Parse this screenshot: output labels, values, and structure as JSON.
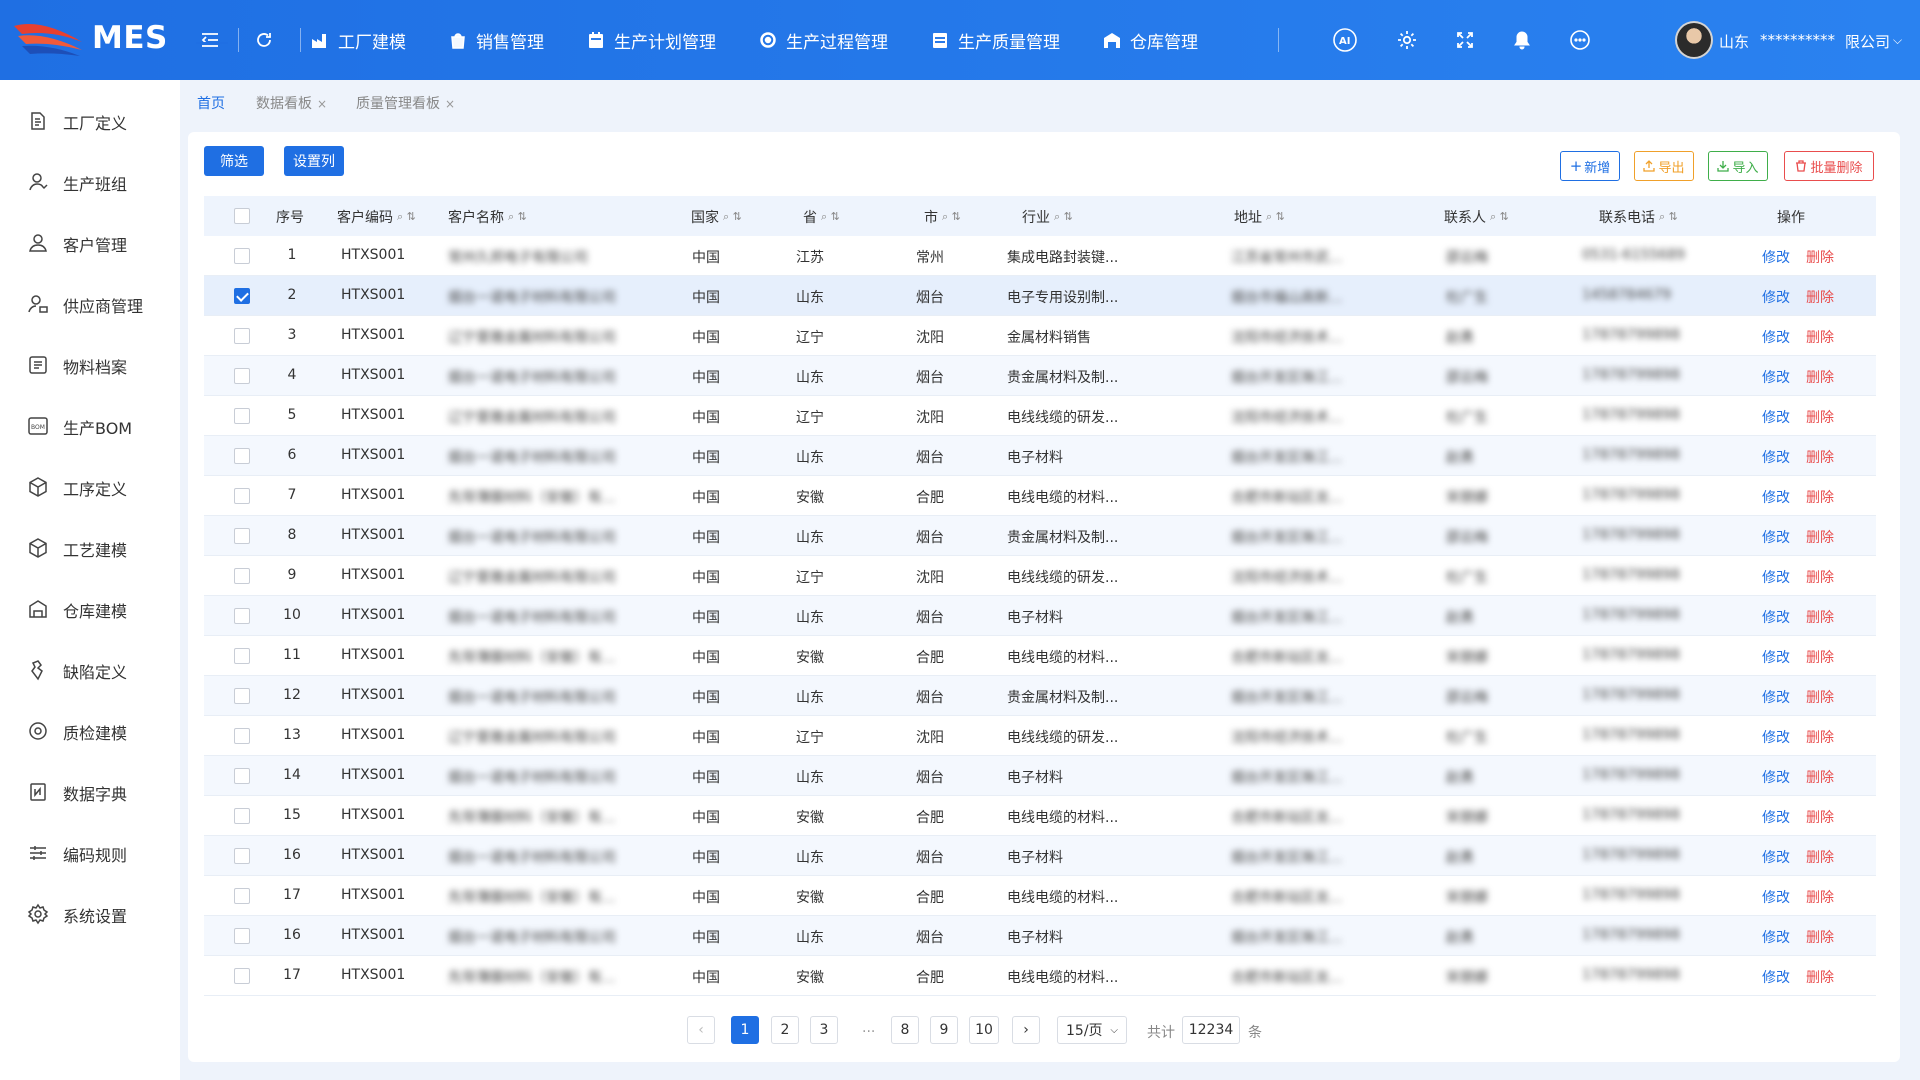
{
  "app": {
    "logo_text": "MES"
  },
  "nav": [
    {
      "label": "工厂建模",
      "icon": "factory-icon"
    },
    {
      "label": "销售管理",
      "icon": "sales-bag-icon"
    },
    {
      "label": "生产计划管理",
      "icon": "calendar-icon"
    },
    {
      "label": "生产过程管理",
      "icon": "process-icon"
    },
    {
      "label": "生产质量管理",
      "icon": "quality-icon"
    },
    {
      "label": "仓库管理",
      "icon": "warehouse-icon"
    }
  ],
  "user": {
    "name": "山东",
    "account": "**********",
    "company": "限公司"
  },
  "sidebar": [
    {
      "label": "工厂定义",
      "icon": "document-icon"
    },
    {
      "label": "生产班组",
      "icon": "user-icon"
    },
    {
      "label": "客户管理",
      "icon": "customer-icon"
    },
    {
      "label": "供应商管理",
      "icon": "supplier-icon"
    },
    {
      "label": "物料档案",
      "icon": "archive-icon"
    },
    {
      "label": "生产BOM",
      "icon": "bom-icon"
    },
    {
      "label": "工序定义",
      "icon": "cube-icon"
    },
    {
      "label": "工艺建模",
      "icon": "cube-icon"
    },
    {
      "label": "仓库建模",
      "icon": "warehouse-icon"
    },
    {
      "label": "缺陷定义",
      "icon": "defect-icon"
    },
    {
      "label": "质检建模",
      "icon": "inspection-icon"
    },
    {
      "label": "数据字典",
      "icon": "dictionary-icon"
    },
    {
      "label": "编码规则",
      "icon": "sliders-icon"
    },
    {
      "label": "系统设置",
      "icon": "gear-icon"
    }
  ],
  "tabs": [
    {
      "label": "首页",
      "active": true,
      "closable": false
    },
    {
      "label": "数据看板",
      "active": false,
      "closable": true
    },
    {
      "label": "质量管理看板",
      "active": false,
      "closable": true
    }
  ],
  "toolbar": {
    "filter": "筛选",
    "columns": "设置列",
    "add": "新增",
    "export": "导出",
    "import": "导入",
    "batch_delete": "批量删除"
  },
  "table": {
    "headers": [
      "序号",
      "客户编码",
      "客户名称",
      "国家",
      "省",
      "市",
      "行业",
      "地址",
      "联系人",
      "联系电话",
      "操作"
    ],
    "actions": {
      "edit": "修改",
      "delete": "删除"
    },
    "rows": [
      {
        "no": "1",
        "code": "HTXS001",
        "name": "常州久邦电子有限公司",
        "country": "中国",
        "province": "江苏",
        "city": "常州",
        "industry": "集成电路封装键...",
        "address": "江苏省常州市武...",
        "contact": "邵云梅",
        "phone": "0531-6155689",
        "checked": false
      },
      {
        "no": "2",
        "code": "HTXS001",
        "name": "烟台一诺电子材料有限公司",
        "country": "中国",
        "province": "山东",
        "city": "烟台",
        "industry": "电子专用设别制...",
        "address": "烟台市福山高新...",
        "contact": "杜广生",
        "phone": "1458784679",
        "checked": true
      },
      {
        "no": "3",
        "code": "HTXS001",
        "name": "辽宁里雅金属材料有限公司",
        "country": "中国",
        "province": "辽宁",
        "city": "沈阳",
        "industry": "金属材料销售",
        "address": "沈阳市经济技术...",
        "contact": "赵勇",
        "phone": "17878799898",
        "checked": false
      },
      {
        "no": "4",
        "code": "HTXS001",
        "name": "烟台一诺电子材料有限公司",
        "country": "中国",
        "province": "山东",
        "city": "烟台",
        "industry": "贵金属材料及制...",
        "address": "烟台开发区珠江...",
        "contact": "邵云梅",
        "phone": "17878799898",
        "checked": false
      },
      {
        "no": "5",
        "code": "HTXS001",
        "name": "辽宁里雅金属材料有限公司",
        "country": "中国",
        "province": "辽宁",
        "city": "沈阳",
        "industry": "电线线缆的研发...",
        "address": "沈阳市经济技术...",
        "contact": "杜广生",
        "phone": "17878799898",
        "checked": false
      },
      {
        "no": "6",
        "code": "HTXS001",
        "name": "烟台一诺电子材料有限公司",
        "country": "中国",
        "province": "山东",
        "city": "烟台",
        "industry": "电子材料",
        "address": "烟台开发区珠江...",
        "contact": "赵勇",
        "phone": "17878799898",
        "checked": false
      },
      {
        "no": "7",
        "code": "HTXS001",
        "name": "先导薄膜材料（安徽）有...",
        "country": "中国",
        "province": "安徽",
        "city": "合肥",
        "industry": "电线电缆的材料...",
        "address": "合肥市新站区龙...",
        "contact": "宋朋娜",
        "phone": "17878799898",
        "checked": false
      },
      {
        "no": "8",
        "code": "HTXS001",
        "name": "烟台一诺电子材料有限公司",
        "country": "中国",
        "province": "山东",
        "city": "烟台",
        "industry": "贵金属材料及制...",
        "address": "烟台开发区珠江...",
        "contact": "邵云梅",
        "phone": "17878799898",
        "checked": false
      },
      {
        "no": "9",
        "code": "HTXS001",
        "name": "辽宁里雅金属材料有限公司",
        "country": "中国",
        "province": "辽宁",
        "city": "沈阳",
        "industry": "电线线缆的研发...",
        "address": "沈阳市经济技术...",
        "contact": "杜广生",
        "phone": "17878799898",
        "checked": false
      },
      {
        "no": "10",
        "code": "HTXS001",
        "name": "烟台一诺电子材料有限公司",
        "country": "中国",
        "province": "山东",
        "city": "烟台",
        "industry": "电子材料",
        "address": "烟台开发区珠江...",
        "contact": "赵勇",
        "phone": "17878799898",
        "checked": false
      },
      {
        "no": "11",
        "code": "HTXS001",
        "name": "先导薄膜材料（安徽）有...",
        "country": "中国",
        "province": "安徽",
        "city": "合肥",
        "industry": "电线电缆的材料...",
        "address": "合肥市新站区龙...",
        "contact": "宋朋娜",
        "phone": "17878799898",
        "checked": false
      },
      {
        "no": "12",
        "code": "HTXS001",
        "name": "烟台一诺电子材料有限公司",
        "country": "中国",
        "province": "山东",
        "city": "烟台",
        "industry": "贵金属材料及制...",
        "address": "烟台开发区珠江...",
        "contact": "邵云梅",
        "phone": "17878799898",
        "checked": false
      },
      {
        "no": "13",
        "code": "HTXS001",
        "name": "辽宁里雅金属材料有限公司",
        "country": "中国",
        "province": "辽宁",
        "city": "沈阳",
        "industry": "电线线缆的研发...",
        "address": "沈阳市经济技术...",
        "contact": "杜广生",
        "phone": "17878799898",
        "checked": false
      },
      {
        "no": "14",
        "code": "HTXS001",
        "name": "烟台一诺电子材料有限公司",
        "country": "中国",
        "province": "山东",
        "city": "烟台",
        "industry": "电子材料",
        "address": "烟台开发区珠江...",
        "contact": "赵勇",
        "phone": "17878799898",
        "checked": false
      },
      {
        "no": "15",
        "code": "HTXS001",
        "name": "先导薄膜材料（安徽）有...",
        "country": "中国",
        "province": "安徽",
        "city": "合肥",
        "industry": "电线电缆的材料...",
        "address": "合肥市新站区龙...",
        "contact": "宋朋娜",
        "phone": "17878799898",
        "checked": false
      },
      {
        "no": "16",
        "code": "HTXS001",
        "name": "烟台一诺电子材料有限公司",
        "country": "中国",
        "province": "山东",
        "city": "烟台",
        "industry": "电子材料",
        "address": "烟台开发区珠江...",
        "contact": "赵勇",
        "phone": "17878799898",
        "checked": false
      },
      {
        "no": "17",
        "code": "HTXS001",
        "name": "先导薄膜材料（安徽）有...",
        "country": "中国",
        "province": "安徽",
        "city": "合肥",
        "industry": "电线电缆的材料...",
        "address": "合肥市新站区龙...",
        "contact": "宋朋娜",
        "phone": "17878799898",
        "checked": false
      },
      {
        "no": "16",
        "code": "HTXS001",
        "name": "烟台一诺电子材料有限公司",
        "country": "中国",
        "province": "山东",
        "city": "烟台",
        "industry": "电子材料",
        "address": "烟台开发区珠江...",
        "contact": "赵勇",
        "phone": "17878799898",
        "checked": false
      },
      {
        "no": "17",
        "code": "HTXS001",
        "name": "先导薄膜材料（安徽）有...",
        "country": "中国",
        "province": "安徽",
        "city": "合肥",
        "industry": "电线电缆的材料...",
        "address": "合肥市新站区龙...",
        "contact": "宋朋娜",
        "phone": "17878799898",
        "checked": false
      }
    ]
  },
  "pagination": {
    "pages": [
      "1",
      "2",
      "3",
      "8",
      "9",
      "10"
    ],
    "current": "1",
    "ellipsis": "...",
    "page_size": "15/页",
    "total_label": "共计",
    "total": "12234",
    "unit": "条"
  },
  "colors": {
    "primary": "#1f6fe3",
    "danger": "#e94d4d",
    "warning": "#f0a02a",
    "success": "#3fae4a"
  }
}
